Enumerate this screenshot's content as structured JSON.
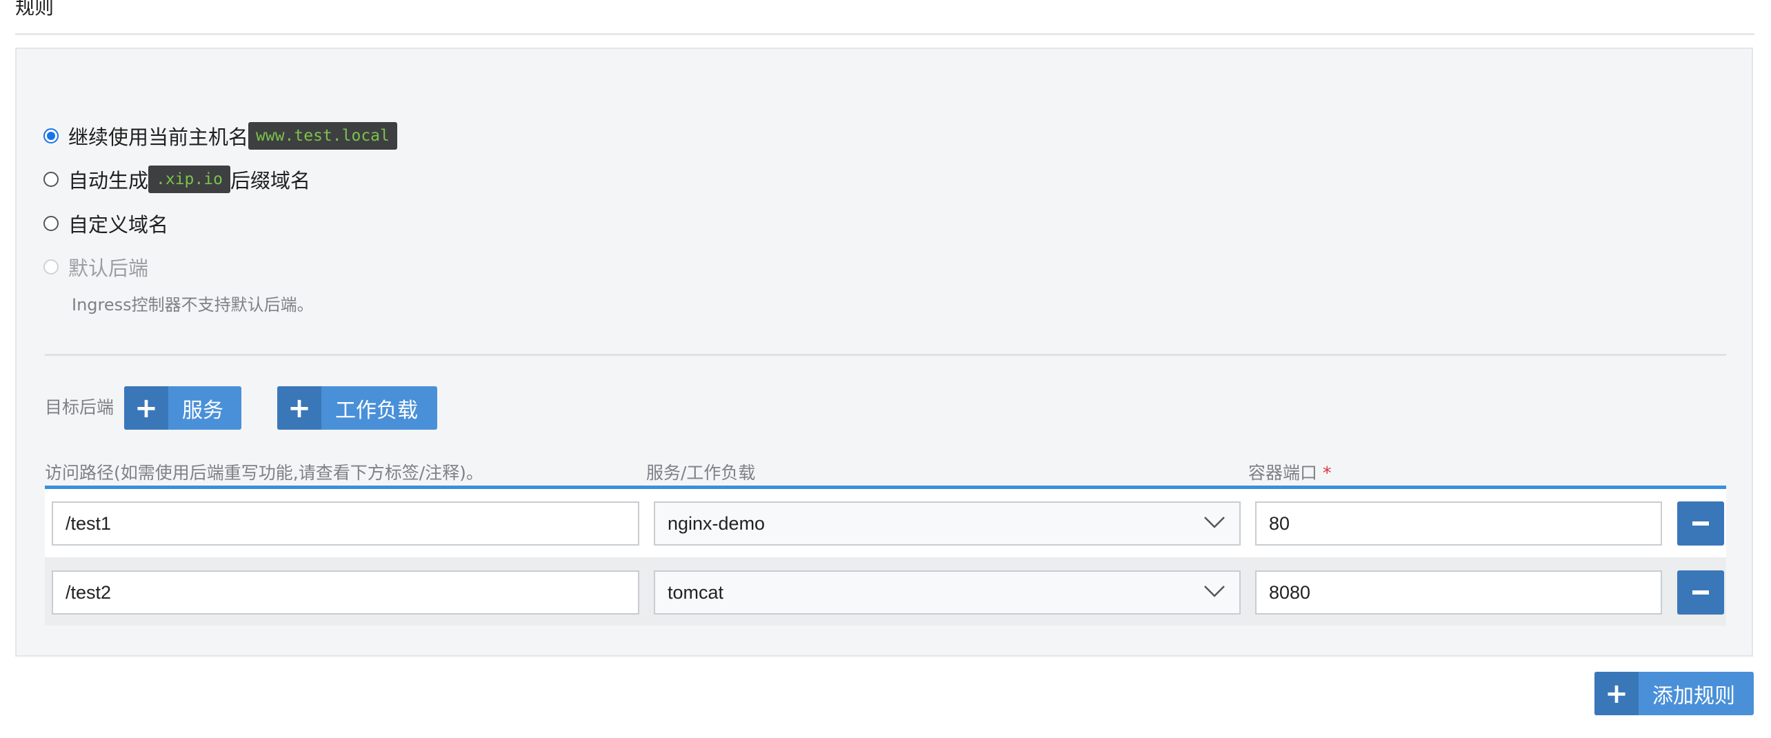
{
  "section": {
    "title": "规则"
  },
  "host_options": [
    {
      "label": "继续使用当前主机名",
      "code": "www.test.local",
      "suffix": "",
      "checked": true,
      "disabled": false
    },
    {
      "label": "自动生成",
      "code": ".xip.io",
      "suffix": "后缀域名",
      "checked": false,
      "disabled": false
    },
    {
      "label": "自定义域名",
      "code": "",
      "suffix": "",
      "checked": false,
      "disabled": false
    },
    {
      "label": "默认后端",
      "code": "",
      "suffix": "",
      "checked": false,
      "disabled": true
    }
  ],
  "default_backend_help": "Ingress控制器不支持默认后端。",
  "target_backend": {
    "label": "目标后端",
    "add_service_label": "服务",
    "add_workload_label": "工作负载"
  },
  "table": {
    "headers": {
      "path": "访问路径(如需使用后端重写功能,请查看下方标签/注释)。",
      "target": "服务/工作负载",
      "port": "容器端口",
      "port_required_mark": "*"
    },
    "rows": [
      {
        "path": "/test1",
        "target": "nginx-demo",
        "port": "80"
      },
      {
        "path": "/test2",
        "target": "tomcat",
        "port": "8080"
      }
    ]
  },
  "add_rule_label": "添加规则",
  "colors": {
    "accent": "#4a90d9",
    "accent_dark": "#3a77b8",
    "radio_checked": "#1a73e8",
    "required": "#d9343a",
    "code_bg": "#3d3f41",
    "code_text": "#7bc24a"
  }
}
